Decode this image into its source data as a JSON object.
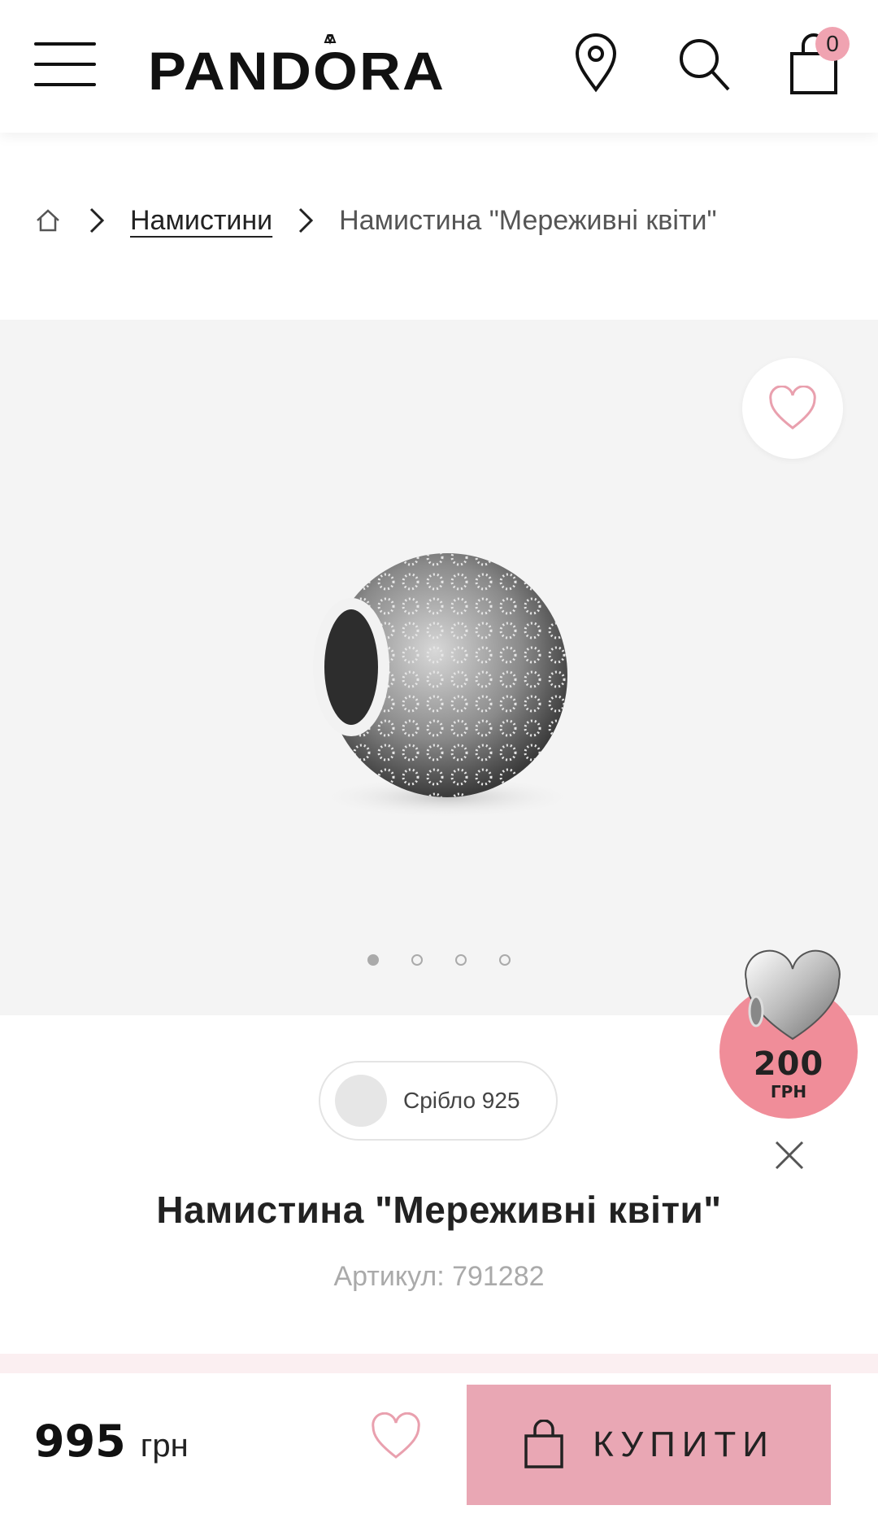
{
  "header": {
    "logo_text": "PANDORA",
    "cart_count": "0",
    "icons": [
      "menu-icon",
      "location-pin-icon",
      "search-icon",
      "shopping-bag-icon"
    ]
  },
  "breadcrumb": {
    "home_icon": "home-icon",
    "category": "Намистини",
    "current": "Намистина \"Мереживні квіти\""
  },
  "gallery": {
    "wishlist_icon": "heart-icon",
    "slide_count": 4,
    "active_slide": 1
  },
  "promo": {
    "amount": "200",
    "unit": "ГРН",
    "close_icon": "close-icon"
  },
  "product": {
    "material": "Срібло 925",
    "title": "Намистина \"Мереживні квіти\"",
    "sku": "Артикул: 791282"
  },
  "bottom_bar": {
    "price": "995",
    "currency": "грн",
    "buy_label": "КУПИТИ"
  },
  "colors": {
    "accent_pink": "#e9a7b4",
    "badge_pink": "#f0a3b1",
    "promo_pink": "#f08d99",
    "gallery_bg": "#f4f4f4"
  }
}
